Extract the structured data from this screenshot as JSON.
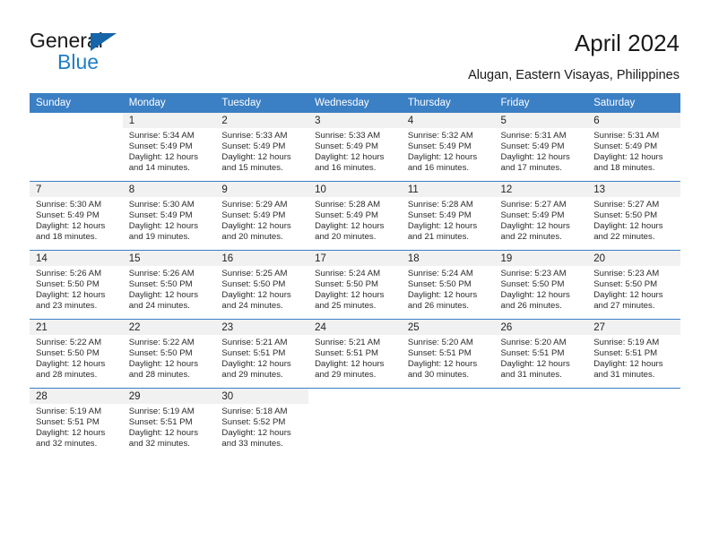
{
  "brand": {
    "logo_line1": "General",
    "logo_line2": "Blue",
    "logo_triangle_color": "#1565a8",
    "logo_blue_text_color": "#1f7ec4"
  },
  "header": {
    "title": "April 2024",
    "subtitle": "Alugan, Eastern Visayas, Philippines"
  },
  "colors": {
    "header_row_background": "#3b7fc4",
    "header_row_text": "#ffffff",
    "daynumber_band": "#f1f1f1",
    "week_separator": "#3b7fc4",
    "body_text": "#2b2b2b"
  },
  "calendar": {
    "weekday_headers": [
      "Sunday",
      "Monday",
      "Tuesday",
      "Wednesday",
      "Thursday",
      "Friday",
      "Saturday"
    ],
    "weeks": [
      [
        {
          "day": "",
          "lines": []
        },
        {
          "day": "1",
          "lines": [
            "Sunrise: 5:34 AM",
            "Sunset: 5:49 PM",
            "Daylight: 12 hours",
            "and 14 minutes."
          ]
        },
        {
          "day": "2",
          "lines": [
            "Sunrise: 5:33 AM",
            "Sunset: 5:49 PM",
            "Daylight: 12 hours",
            "and 15 minutes."
          ]
        },
        {
          "day": "3",
          "lines": [
            "Sunrise: 5:33 AM",
            "Sunset: 5:49 PM",
            "Daylight: 12 hours",
            "and 16 minutes."
          ]
        },
        {
          "day": "4",
          "lines": [
            "Sunrise: 5:32 AM",
            "Sunset: 5:49 PM",
            "Daylight: 12 hours",
            "and 16 minutes."
          ]
        },
        {
          "day": "5",
          "lines": [
            "Sunrise: 5:31 AM",
            "Sunset: 5:49 PM",
            "Daylight: 12 hours",
            "and 17 minutes."
          ]
        },
        {
          "day": "6",
          "lines": [
            "Sunrise: 5:31 AM",
            "Sunset: 5:49 PM",
            "Daylight: 12 hours",
            "and 18 minutes."
          ]
        }
      ],
      [
        {
          "day": "7",
          "lines": [
            "Sunrise: 5:30 AM",
            "Sunset: 5:49 PM",
            "Daylight: 12 hours",
            "and 18 minutes."
          ]
        },
        {
          "day": "8",
          "lines": [
            "Sunrise: 5:30 AM",
            "Sunset: 5:49 PM",
            "Daylight: 12 hours",
            "and 19 minutes."
          ]
        },
        {
          "day": "9",
          "lines": [
            "Sunrise: 5:29 AM",
            "Sunset: 5:49 PM",
            "Daylight: 12 hours",
            "and 20 minutes."
          ]
        },
        {
          "day": "10",
          "lines": [
            "Sunrise: 5:28 AM",
            "Sunset: 5:49 PM",
            "Daylight: 12 hours",
            "and 20 minutes."
          ]
        },
        {
          "day": "11",
          "lines": [
            "Sunrise: 5:28 AM",
            "Sunset: 5:49 PM",
            "Daylight: 12 hours",
            "and 21 minutes."
          ]
        },
        {
          "day": "12",
          "lines": [
            "Sunrise: 5:27 AM",
            "Sunset: 5:49 PM",
            "Daylight: 12 hours",
            "and 22 minutes."
          ]
        },
        {
          "day": "13",
          "lines": [
            "Sunrise: 5:27 AM",
            "Sunset: 5:50 PM",
            "Daylight: 12 hours",
            "and 22 minutes."
          ]
        }
      ],
      [
        {
          "day": "14",
          "lines": [
            "Sunrise: 5:26 AM",
            "Sunset: 5:50 PM",
            "Daylight: 12 hours",
            "and 23 minutes."
          ]
        },
        {
          "day": "15",
          "lines": [
            "Sunrise: 5:26 AM",
            "Sunset: 5:50 PM",
            "Daylight: 12 hours",
            "and 24 minutes."
          ]
        },
        {
          "day": "16",
          "lines": [
            "Sunrise: 5:25 AM",
            "Sunset: 5:50 PM",
            "Daylight: 12 hours",
            "and 24 minutes."
          ]
        },
        {
          "day": "17",
          "lines": [
            "Sunrise: 5:24 AM",
            "Sunset: 5:50 PM",
            "Daylight: 12 hours",
            "and 25 minutes."
          ]
        },
        {
          "day": "18",
          "lines": [
            "Sunrise: 5:24 AM",
            "Sunset: 5:50 PM",
            "Daylight: 12 hours",
            "and 26 minutes."
          ]
        },
        {
          "day": "19",
          "lines": [
            "Sunrise: 5:23 AM",
            "Sunset: 5:50 PM",
            "Daylight: 12 hours",
            "and 26 minutes."
          ]
        },
        {
          "day": "20",
          "lines": [
            "Sunrise: 5:23 AM",
            "Sunset: 5:50 PM",
            "Daylight: 12 hours",
            "and 27 minutes."
          ]
        }
      ],
      [
        {
          "day": "21",
          "lines": [
            "Sunrise: 5:22 AM",
            "Sunset: 5:50 PM",
            "Daylight: 12 hours",
            "and 28 minutes."
          ]
        },
        {
          "day": "22",
          "lines": [
            "Sunrise: 5:22 AM",
            "Sunset: 5:50 PM",
            "Daylight: 12 hours",
            "and 28 minutes."
          ]
        },
        {
          "day": "23",
          "lines": [
            "Sunrise: 5:21 AM",
            "Sunset: 5:51 PM",
            "Daylight: 12 hours",
            "and 29 minutes."
          ]
        },
        {
          "day": "24",
          "lines": [
            "Sunrise: 5:21 AM",
            "Sunset: 5:51 PM",
            "Daylight: 12 hours",
            "and 29 minutes."
          ]
        },
        {
          "day": "25",
          "lines": [
            "Sunrise: 5:20 AM",
            "Sunset: 5:51 PM",
            "Daylight: 12 hours",
            "and 30 minutes."
          ]
        },
        {
          "day": "26",
          "lines": [
            "Sunrise: 5:20 AM",
            "Sunset: 5:51 PM",
            "Daylight: 12 hours",
            "and 31 minutes."
          ]
        },
        {
          "day": "27",
          "lines": [
            "Sunrise: 5:19 AM",
            "Sunset: 5:51 PM",
            "Daylight: 12 hours",
            "and 31 minutes."
          ]
        }
      ],
      [
        {
          "day": "28",
          "lines": [
            "Sunrise: 5:19 AM",
            "Sunset: 5:51 PM",
            "Daylight: 12 hours",
            "and 32 minutes."
          ]
        },
        {
          "day": "29",
          "lines": [
            "Sunrise: 5:19 AM",
            "Sunset: 5:51 PM",
            "Daylight: 12 hours",
            "and 32 minutes."
          ]
        },
        {
          "day": "30",
          "lines": [
            "Sunrise: 5:18 AM",
            "Sunset: 5:52 PM",
            "Daylight: 12 hours",
            "and 33 minutes."
          ]
        },
        {
          "day": "",
          "lines": []
        },
        {
          "day": "",
          "lines": []
        },
        {
          "day": "",
          "lines": []
        },
        {
          "day": "",
          "lines": []
        }
      ]
    ]
  }
}
